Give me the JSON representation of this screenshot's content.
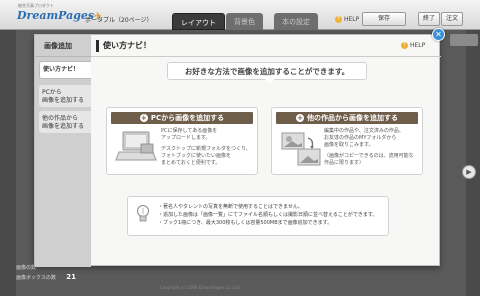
{
  "app": {
    "logo_sub": "総合写真プロダクト",
    "logo": "DreamPages",
    "edition": "ポータブル（20ページ）",
    "tabs": [
      "レイアウト",
      "背景色",
      "本の設定"
    ],
    "help": "HELP",
    "save": "保存",
    "finish": "終了",
    "order": "注文",
    "stats": [
      {
        "label": "画像の数",
        "value": ""
      },
      {
        "label": "画像ボックスの数",
        "value": "21"
      }
    ],
    "copyright": "Copyright (c) 2009 DreamPages Co.,Ltd."
  },
  "modal": {
    "title": "画像追加",
    "menu": [
      "使い方ナビ！",
      "PCから\n画像を追加する",
      "他の作品から\n画像を追加する"
    ],
    "heading": "使い方ナビ！",
    "help": "HELP",
    "bubble": "お好きな方法で画像を追加することができます。",
    "card_pc": {
      "title": "PCから画像を追加する",
      "text1": "PCに保存してある画像を\nアップロードします。",
      "text2": "デスクトップに新規フォルダをつくり、\nフォトブックに使いたい画像を\nまとめておくと便利です。"
    },
    "card_other": {
      "title": "他の作品から画像を追加する",
      "text1": "編集中の作品や、注文済みの作品、\nお友達の作品のMYフォルダから\n画像を取りこみます。",
      "text2": "（画像がコピーできるのは、流用可能な\n作品に限ります）"
    },
    "tips": [
      "・著名人やタレントの写真を無断で使用することはできません。",
      "・追加した画像は「画像一覧」にてファイル名順もしくは撮影日順に並べ替えることができます。",
      "・ブック1冊につき、最大300枚もしくは容量500MBまで画像追加できます。"
    ]
  }
}
